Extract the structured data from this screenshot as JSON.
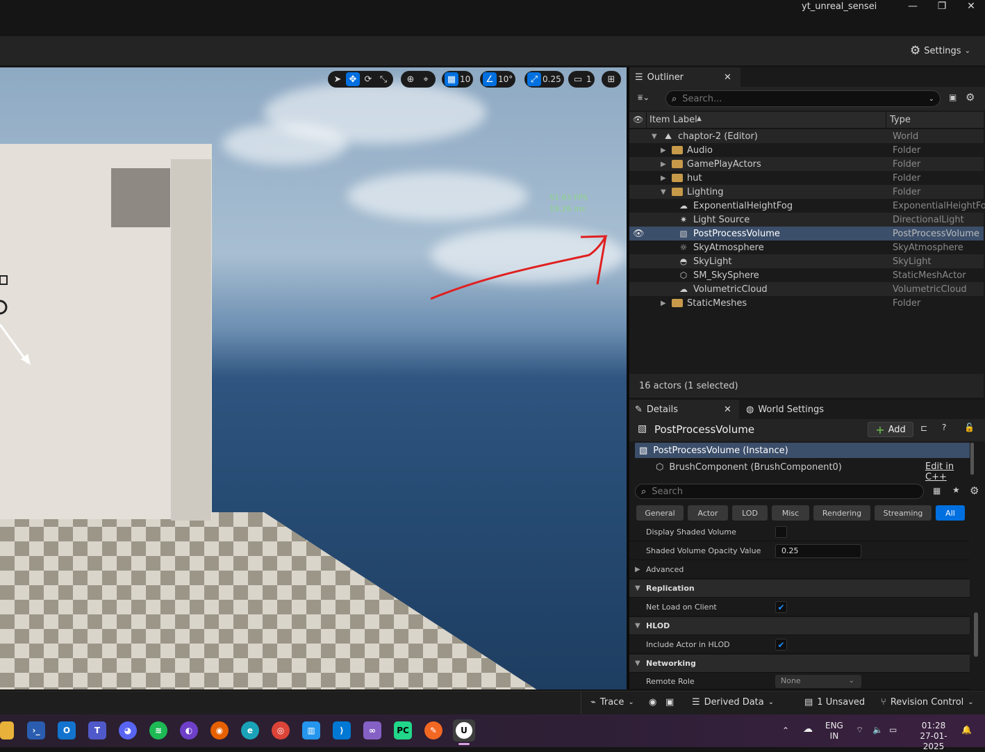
{
  "window": {
    "user": "yt_unreal_sensei",
    "minimize": "—",
    "maximize": "❐",
    "close": "✕"
  },
  "toolbar": {
    "settings_label": "Settings"
  },
  "viewport": {
    "fps": "51.93 FPS",
    "ms": "19.26 ms",
    "grid_snap": "10",
    "rotation_snap": "10°",
    "scale_snap": "0.25",
    "camera_speed": "1"
  },
  "outliner": {
    "tab_label": "Outliner",
    "search_placeholder": "Search...",
    "col_label": "Item Label",
    "col_type": "Type",
    "rows": [
      {
        "label": "chaptor-2 (Editor)",
        "type": "World"
      },
      {
        "label": "Audio",
        "type": "Folder"
      },
      {
        "label": "GamePlayActors",
        "type": "Folder"
      },
      {
        "label": "hut",
        "type": "Folder"
      },
      {
        "label": "Lighting",
        "type": "Folder"
      },
      {
        "label": "ExponentialHeightFog",
        "type": "ExponentialHeightFog"
      },
      {
        "label": "Light Source",
        "type": "DirectionalLight"
      },
      {
        "label": "PostProcessVolume",
        "type": "PostProcessVolume"
      },
      {
        "label": "SkyAtmosphere",
        "type": "SkyAtmosphere"
      },
      {
        "label": "SkyLight",
        "type": "SkyLight"
      },
      {
        "label": "SM_SkySphere",
        "type": "StaticMeshActor"
      },
      {
        "label": "VolumetricCloud",
        "type": "VolumetricCloud"
      },
      {
        "label": "StaticMeshes",
        "type": "Folder"
      }
    ],
    "status": "16 actors (1 selected)"
  },
  "details": {
    "tab_label": "Details",
    "world_settings_label": "World Settings",
    "object_name": "PostProcessVolume",
    "add_label": "Add",
    "instance_label": "PostProcessVolume (Instance)",
    "component_label": "BrushComponent (BrushComponent0)",
    "edit_cpp": "Edit in C++",
    "search_placeholder": "Search",
    "filters": [
      "General",
      "Actor",
      "LOD",
      "Misc",
      "Rendering",
      "Streaming",
      "All"
    ],
    "props": {
      "display_shaded": "Display Shaded Volume",
      "opacity_label": "Shaded Volume Opacity Value",
      "opacity_value": "0.25",
      "advanced": "Advanced",
      "replication": "Replication",
      "net_load": "Net Load on Client",
      "hlod": "HLOD",
      "include_hlod": "Include Actor in HLOD",
      "networking": "Networking",
      "remote_role": "Remote Role",
      "remote_role_value": "None"
    }
  },
  "statusbar": {
    "trace": "Trace",
    "derived_data": "Derived Data",
    "unsaved": "1 Unsaved",
    "revision_control": "Revision Control"
  },
  "taskbar": {
    "lang1": "ENG",
    "lang2": "IN",
    "time": "01:28",
    "date": "27-01-2025"
  },
  "colors": {
    "accent": "#0070e0",
    "selection": "#3b4e6a",
    "annotation": "#e02020"
  }
}
